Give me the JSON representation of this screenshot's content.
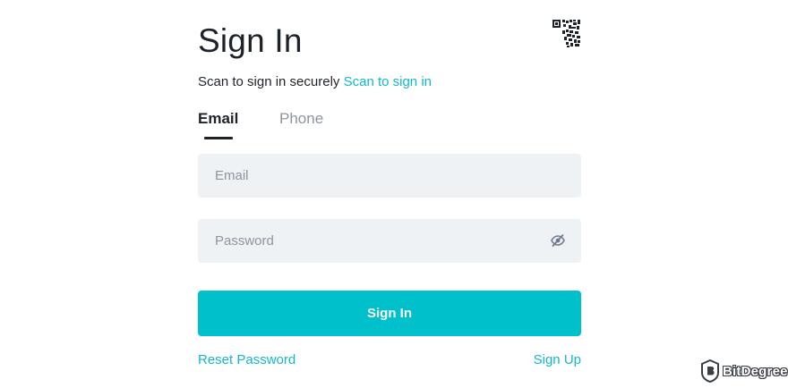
{
  "header": {
    "title": "Sign In",
    "qr_icon": "qr-code-icon"
  },
  "scan": {
    "text": "Scan to sign in securely",
    "link": "Scan to sign in"
  },
  "tabs": [
    {
      "label": "Email",
      "active": true
    },
    {
      "label": "Phone",
      "active": false
    }
  ],
  "form": {
    "email": {
      "placeholder": "Email",
      "value": ""
    },
    "password": {
      "placeholder": "Password",
      "value": "",
      "visibility_icon": "eye-slash-icon"
    },
    "submit_label": "Sign In"
  },
  "links": {
    "reset": "Reset Password",
    "signup": "Sign Up"
  },
  "watermark": {
    "text": "BitDegree"
  },
  "colors": {
    "accent": "#00c0cc",
    "link": "#14b7c9",
    "text": "#1e2329",
    "muted": "#8e959f",
    "field_bg": "#eef2f5"
  }
}
